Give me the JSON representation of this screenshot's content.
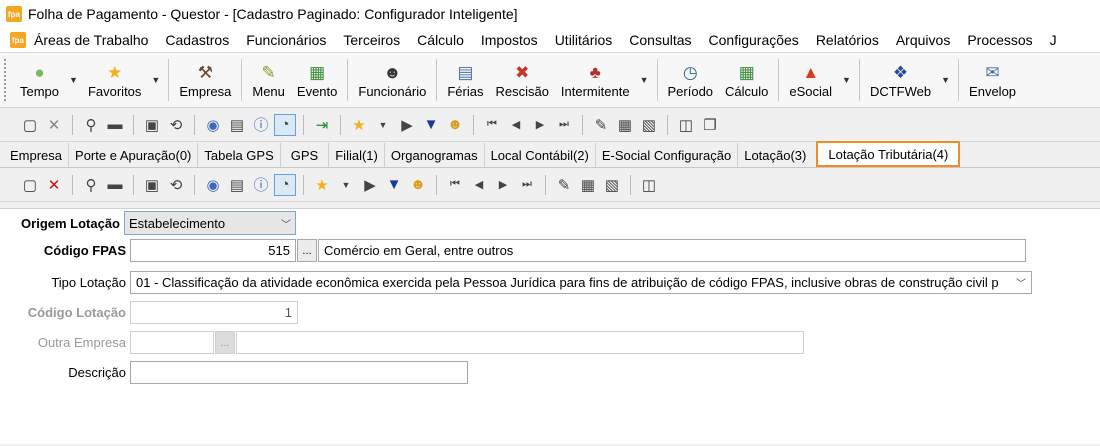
{
  "window": {
    "title": "Folha de Pagamento - Questor - [Cadastro Paginado: Configurador Inteligente]",
    "app_icon": "fpa"
  },
  "menu": [
    "Áreas de Trabalho",
    "Cadastros",
    "Funcionários",
    "Terceiros",
    "Cálculo",
    "Impostos",
    "Utilitários",
    "Consultas",
    "Configurações",
    "Relatórios",
    "Arquivos",
    "Processos",
    "J"
  ],
  "bigbar": {
    "tempo": "Tempo",
    "favoritos": "Favoritos",
    "empresa": "Empresa",
    "menu": "Menu",
    "evento": "Evento",
    "funcionario": "Funcionário",
    "ferias": "Férias",
    "rescisao": "Rescisão",
    "intermitente": "Intermitente",
    "periodo": "Período",
    "calculo": "Cálculo",
    "esocial": "eSocial",
    "dctfweb": "DCTFWeb",
    "envelope": "Envelop"
  },
  "tabs": [
    "Empresa",
    "Porte e Apuração(0)",
    "Tabela GPS",
    "GPS",
    "Filial(1)",
    "Organogramas",
    "Local Contábil(2)",
    "E-Social Configuração",
    "Lotação(3)"
  ],
  "active_tab": "Lotação Tributária(4)",
  "form": {
    "origem_label": "Origem Lotação",
    "origem_value": "Estabelecimento",
    "fpas_label": "Código FPAS",
    "fpas_code": "515",
    "fpas_desc": "Comércio em Geral, entre outros",
    "tipo_label": "Tipo Lotação",
    "tipo_value": "01 - Classificação da atividade econômica exercida pela Pessoa Jurídica para fins de atribuição de código FPAS, inclusive obras de construção civil p",
    "codigo_label": "Código Lotação",
    "codigo_value": "1",
    "outra_label": "Outra Empresa",
    "outra_code": "",
    "outra_name": "",
    "descricao_label": "Descrição",
    "descricao_value": "",
    "ellipsis": "..."
  }
}
